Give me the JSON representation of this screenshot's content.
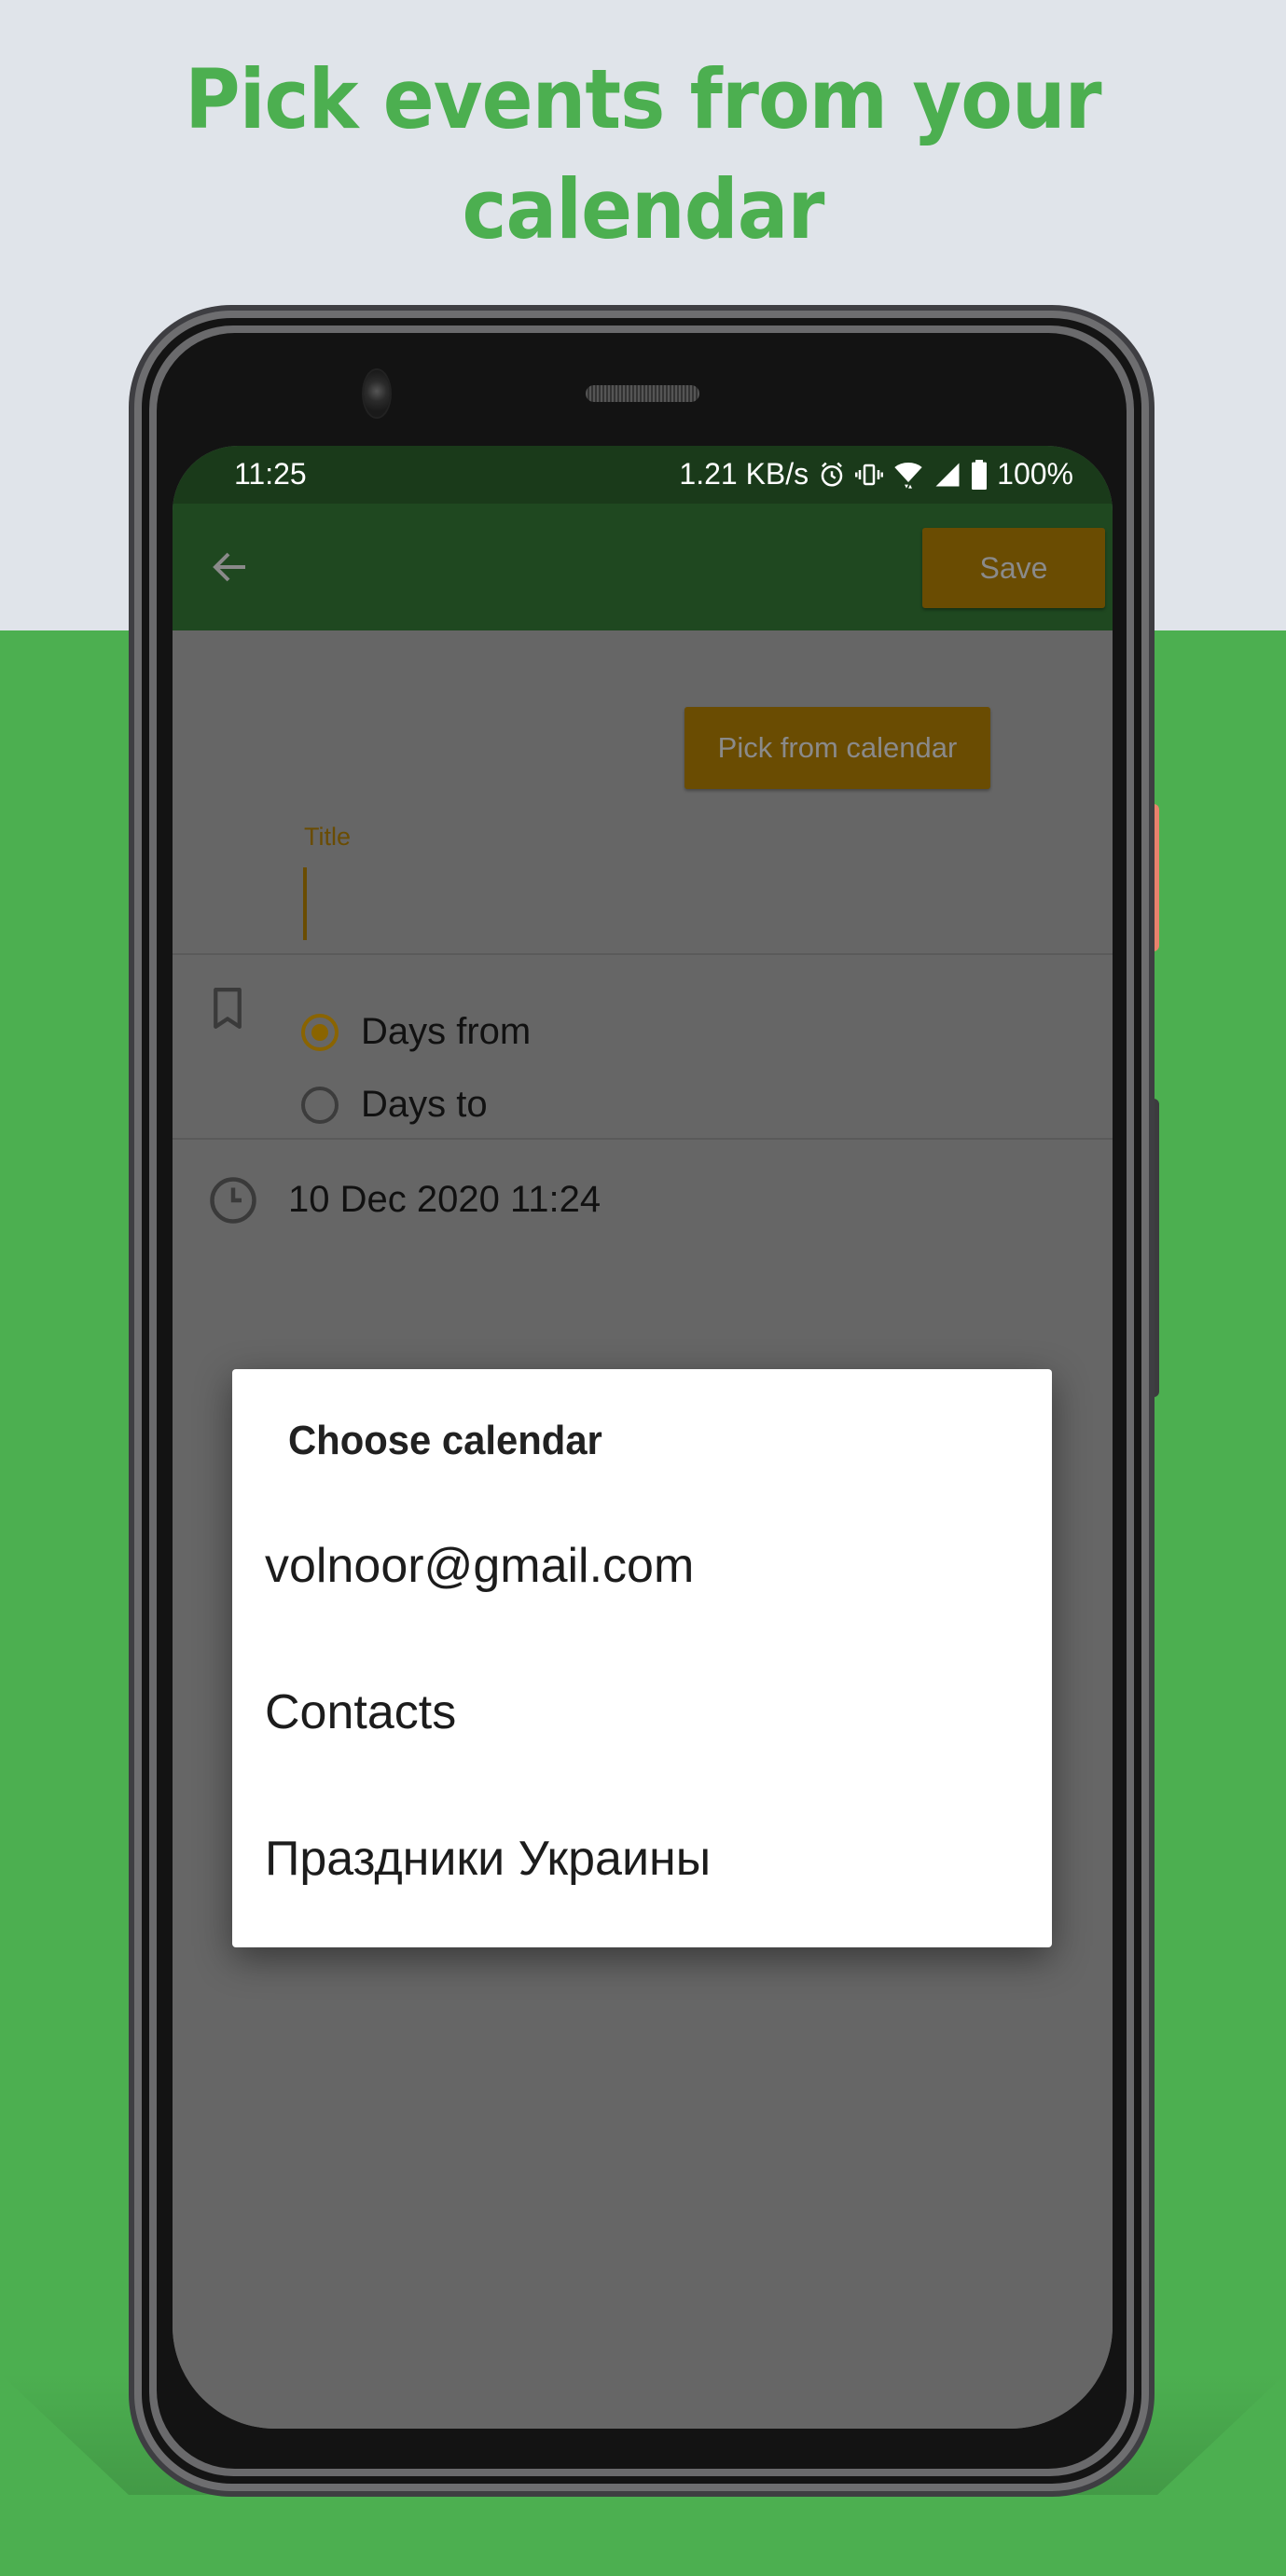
{
  "promo": {
    "headline_line1": "Pick events from your",
    "headline_line2": "calendar"
  },
  "colors": {
    "brand_green": "#4caf50",
    "toolbar_green": "#1f4820",
    "accent_amber": "#8a6400",
    "top_background": "#e0e4ea"
  },
  "status_bar": {
    "time": "11:25",
    "network_speed": "1.21 KB/s",
    "icons": [
      "alarm-icon",
      "vibrate-icon",
      "wifi-icon",
      "signal-icon",
      "battery-icon"
    ],
    "battery": "100%"
  },
  "toolbar": {
    "back_icon": "arrow-left-icon",
    "save_label": "Save"
  },
  "form": {
    "pick_from_calendar_label": "Pick from calendar",
    "title_label": "Title",
    "title_value": "",
    "mode_options": [
      {
        "label": "Days from",
        "checked": true
      },
      {
        "label": "Days to",
        "checked": false
      }
    ],
    "date_value": "10 Dec 2020 11:24"
  },
  "dialog": {
    "title": "Choose calendar",
    "items": [
      "volnoor@gmail.com",
      "Contacts",
      "Праздники Украины"
    ]
  }
}
